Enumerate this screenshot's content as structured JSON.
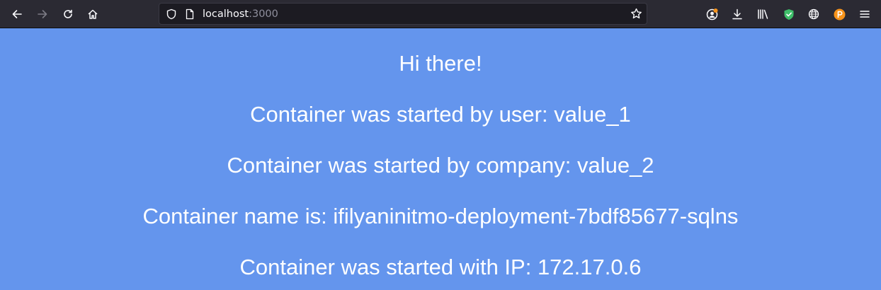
{
  "browser": {
    "toolbar": {
      "back_icon": "arrow-left-icon",
      "forward_icon": "arrow-right-icon",
      "reload_icon": "reload-icon",
      "home_icon": "home-icon",
      "shield_icon": "tracking-protection-shield-icon",
      "page_icon": "page-info-icon",
      "bookmark_icon": "star-icon",
      "account_icon": "account-icon",
      "downloads_icon": "download-icon",
      "library_icon": "library-icon",
      "extension_shield_icon": "green-shield-extension-icon",
      "globe_icon": "globe-icon",
      "orange_extension_icon": "orange-circle-extension-icon",
      "menu_icon": "hamburger-menu-icon"
    },
    "url": {
      "host": "localhost",
      "port": ":3000"
    },
    "colors": {
      "toolbar_bg": "#2b2a33",
      "urlbar_bg": "#1c1b22",
      "page_bg": "#6495ed",
      "text": "#ffffff",
      "shield_green": "#3fbf6a",
      "extension_orange": "#f7931a"
    }
  },
  "page": {
    "greeting": "Hi there!",
    "user_line": "Container was started by user: value_1",
    "company_line": "Container was started by company: value_2",
    "name_line": "Container name is: ifilyaninitmo-deployment-7bdf85677-sqlns",
    "ip_line": "Container was started with IP: 172.17.0.6"
  }
}
